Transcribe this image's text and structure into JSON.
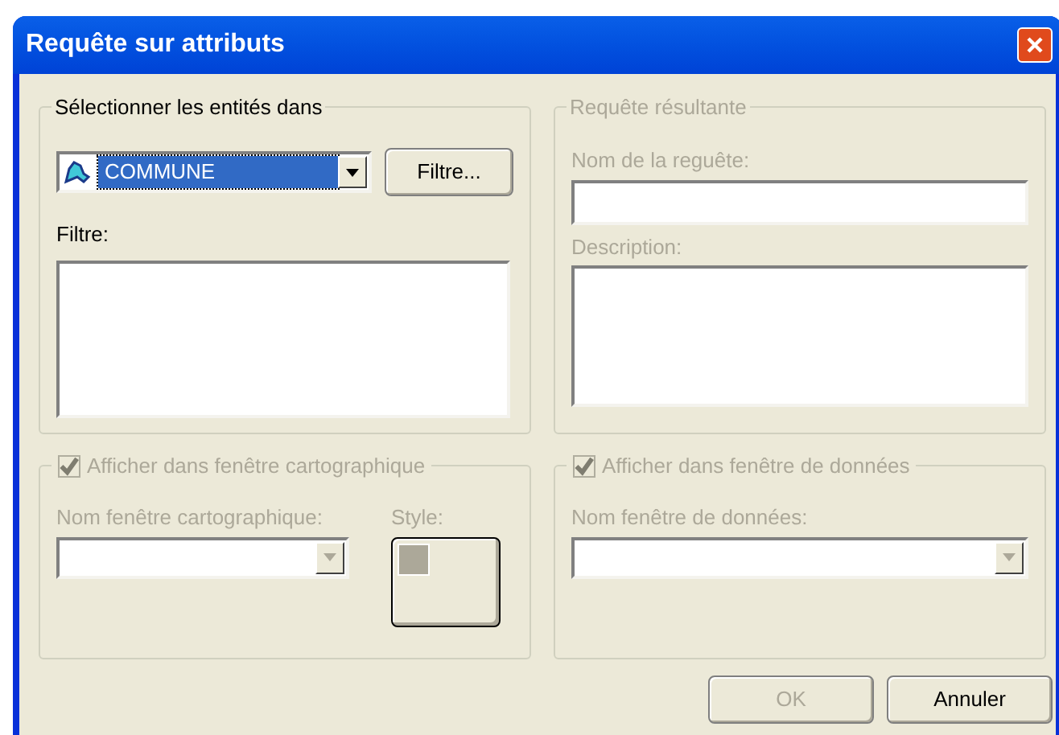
{
  "window": {
    "title": "Requête sur attributs"
  },
  "source_group": {
    "label": "Sélectionner les entités dans",
    "disabled": false,
    "layer_select": {
      "value": "COMMUNE"
    },
    "filter_button": {
      "label": "Filtre...",
      "disabled": false
    },
    "filter_label": "Filtre:"
  },
  "result_group": {
    "label": "Requête résultante",
    "disabled": true,
    "name_label": "Nom de la reguête:",
    "description_label": "Description:"
  },
  "map_group": {
    "disabled": true,
    "checkbox": {
      "label": "Afficher dans fenêtre cartographique",
      "checked": true
    },
    "window_label": "Nom fenêtre cartographique:",
    "style_label": "Style:"
  },
  "data_group": {
    "disabled": true,
    "checkbox": {
      "label": "Afficher dans fenêtre de données",
      "checked": true
    },
    "window_label": "Nom fenêtre de données:"
  },
  "buttons": [
    {
      "label": "OK",
      "disabled": true
    },
    {
      "label": "Annuler",
      "disabled": false
    }
  ]
}
